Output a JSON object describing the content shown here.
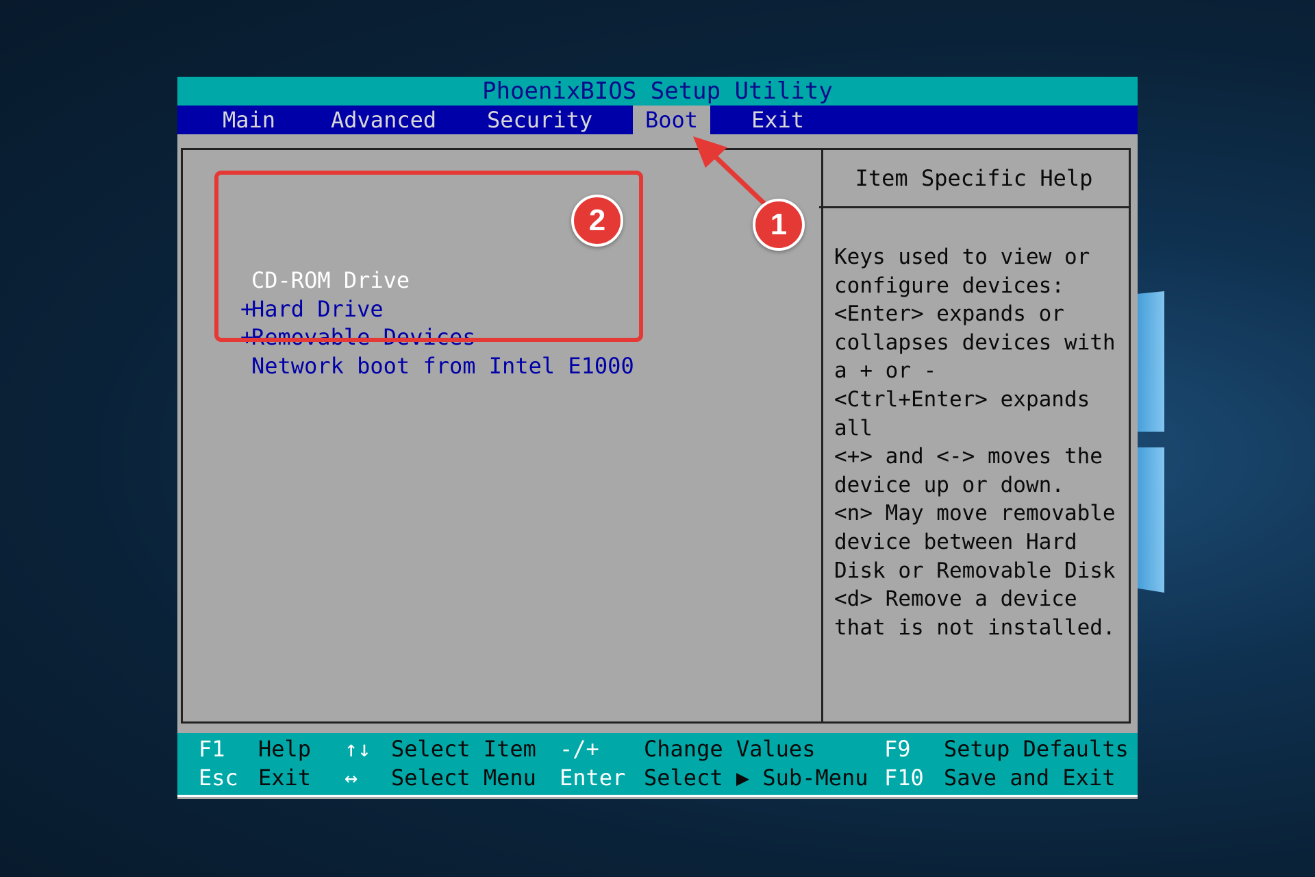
{
  "title": "PhoenixBIOS Setup Utility",
  "menu": [
    {
      "label": "Main",
      "active": false
    },
    {
      "label": "Advanced",
      "active": false
    },
    {
      "label": "Security",
      "active": false
    },
    {
      "label": "Boot",
      "active": true
    },
    {
      "label": "Exit",
      "active": false
    }
  ],
  "boot_items": [
    {
      "prefix": "",
      "label": "CD-ROM Drive",
      "selected": true
    },
    {
      "prefix": "+",
      "label": "Hard Drive",
      "selected": false
    },
    {
      "prefix": "+",
      "label": "Removable Devices",
      "selected": false
    },
    {
      "prefix": "",
      "label": "Network boot from Intel E1000",
      "selected": false
    }
  ],
  "help": {
    "title": "Item Specific Help",
    "lines": [
      "Keys used to view or",
      "configure devices:",
      "<Enter> expands or",
      "collapses devices with",
      "a + or -",
      "<Ctrl+Enter> expands",
      "all",
      "<+> and <-> moves the",
      "device up or down.",
      "<n> May move removable",
      "device between Hard",
      "Disk or Removable Disk",
      "<d> Remove a device",
      "that is not installed."
    ]
  },
  "status": {
    "row1": {
      "k1": "F1",
      "d1": "Help",
      "k2": "↑↓",
      "d2": "Select Item",
      "k3": "-/+",
      "d3": "Change Values",
      "k4": "F9",
      "d4": "Setup Defaults"
    },
    "row2": {
      "k1": "Esc",
      "d1": "Exit",
      "k2": "↔",
      "d2": "Select Menu",
      "k3": "Enter",
      "d3": "Select ▶ Sub-Menu",
      "k4": "F10",
      "d4": "Save and Exit"
    }
  },
  "annotations": {
    "badge1": "1",
    "badge2": "2",
    "color": "#e53935"
  },
  "colors": {
    "bios_blue": "#0000a8",
    "bios_cyan": "#00a8a8",
    "bios_gray": "#a8a8a8"
  }
}
